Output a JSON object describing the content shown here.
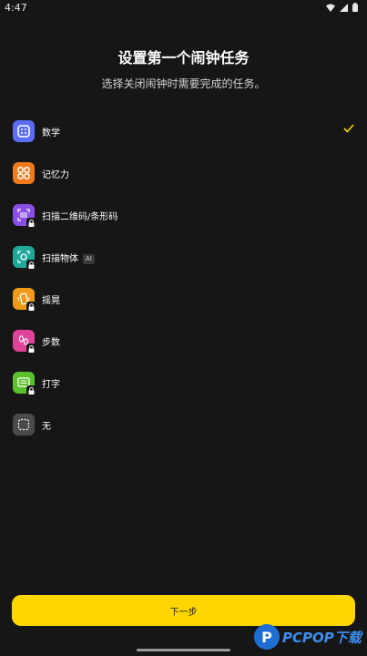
{
  "status_bar": {
    "time": "4:47",
    "icons": [
      "wifi-icon",
      "signal-icon",
      "battery-icon"
    ]
  },
  "header": {
    "title": "设置第一个闹钟任务",
    "subtitle": "选择关闭闹钟时需要完成的任务。"
  },
  "tasks": [
    {
      "label": "数学",
      "icon": "math-dice-icon",
      "color": "#5b6cf5",
      "locked": false,
      "selected": true
    },
    {
      "label": "记忆力",
      "icon": "memory-grid-icon",
      "color": "#f07a1e",
      "locked": false,
      "selected": false
    },
    {
      "label": "扫描二维码/条形码",
      "icon": "barcode-scan-icon",
      "color": "#8b4ee8",
      "locked": true,
      "selected": false
    },
    {
      "label": "扫描物体",
      "icon": "camera-scan-icon",
      "color": "#1fa89a",
      "locked": true,
      "selected": false,
      "badge": "AI"
    },
    {
      "label": "摇晃",
      "icon": "shake-phone-icon",
      "color": "#f09a1a",
      "locked": true,
      "selected": false
    },
    {
      "label": "步数",
      "icon": "footsteps-icon",
      "color": "#e0449a",
      "locked": true,
      "selected": false
    },
    {
      "label": "打字",
      "icon": "keyboard-icon",
      "color": "#5cc02c",
      "locked": true,
      "selected": false
    },
    {
      "label": "无",
      "icon": "none-dashed-icon",
      "color": "#4a4a4a",
      "locked": false,
      "selected": false
    }
  ],
  "footer": {
    "next_label": "下一步"
  },
  "accent_color": "#ffd600",
  "watermark": {
    "text": "PCPOP下载"
  }
}
